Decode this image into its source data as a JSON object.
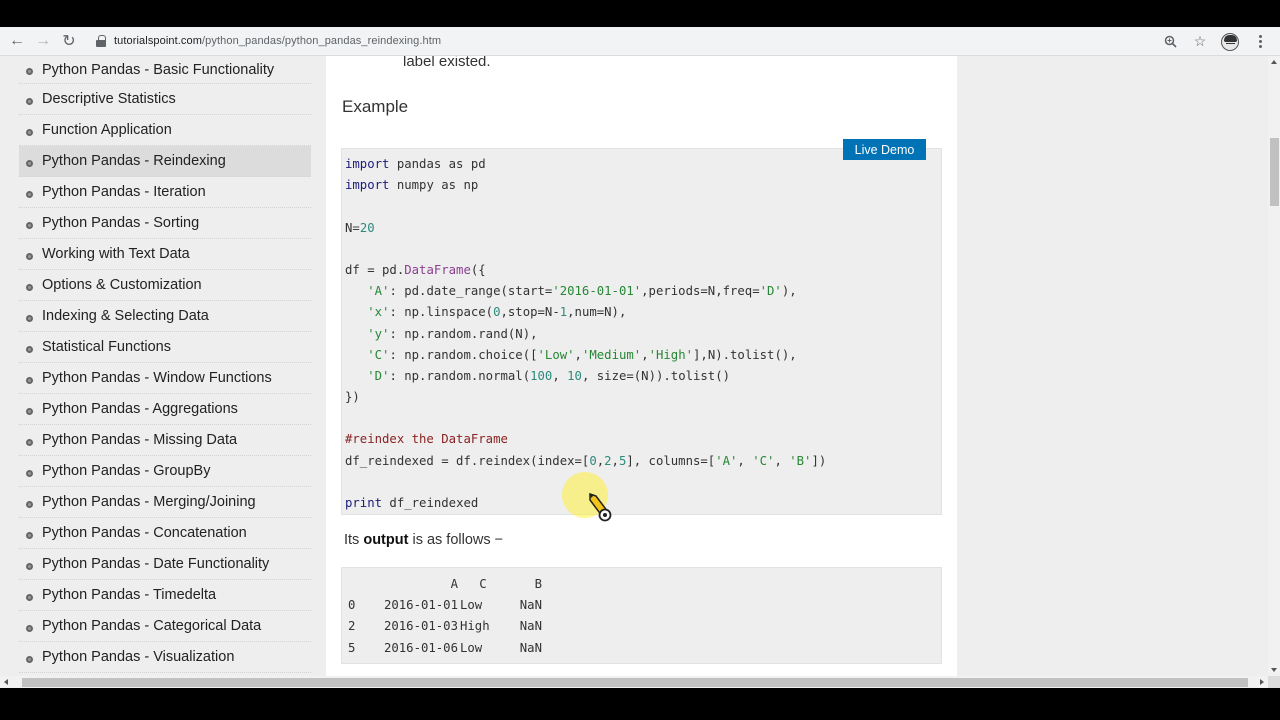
{
  "browser": {
    "url_host": "tutorialspoint.com",
    "url_path": "/python_pandas/python_pandas_reindexing.htm",
    "icons": [
      "back-arrow-icon",
      "forward-arrow-icon",
      "reload-icon",
      "lock-icon",
      "zoom-icon",
      "star-icon",
      "profile-avatar",
      "menu-kebab-icon"
    ]
  },
  "sidebar": {
    "active_index": 3,
    "items": [
      {
        "label": "Python Pandas - Basic Functionality"
      },
      {
        "label": "Descriptive Statistics"
      },
      {
        "label": "Function Application"
      },
      {
        "label": "Python Pandas - Reindexing"
      },
      {
        "label": "Python Pandas - Iteration"
      },
      {
        "label": "Python Pandas - Sorting"
      },
      {
        "label": "Working with Text Data"
      },
      {
        "label": "Options & Customization"
      },
      {
        "label": "Indexing & Selecting Data"
      },
      {
        "label": "Statistical Functions"
      },
      {
        "label": "Python Pandas - Window Functions"
      },
      {
        "label": "Python Pandas - Aggregations"
      },
      {
        "label": "Python Pandas - Missing Data"
      },
      {
        "label": "Python Pandas - GroupBy"
      },
      {
        "label": "Python Pandas - Merging/Joining"
      },
      {
        "label": "Python Pandas - Concatenation"
      },
      {
        "label": "Python Pandas - Date Functionality"
      },
      {
        "label": "Python Pandas - Timedelta"
      },
      {
        "label": "Python Pandas - Categorical Data"
      },
      {
        "label": "Python Pandas - Visualization"
      }
    ]
  },
  "content": {
    "partial_text": "label existed.",
    "example_heading": "Example",
    "live_demo_label": "Live Demo",
    "live_demo_color": "#0073b7",
    "code": {
      "l1": {
        "kw": "import",
        "rest": " pandas as pd"
      },
      "l2": {
        "kw": "import",
        "rest": " numpy as np"
      },
      "l4": {
        "a": "N",
        "b": "=",
        "c": "20"
      },
      "l6": {
        "a": "df = pd.",
        "b": "DataFrame",
        "c": "({"
      },
      "l7": {
        "a": "   ",
        "b": "'A'",
        "c": ": pd.date_range(start=",
        "d": "'2016-01-01'",
        "e": ",periods=N,freq=",
        "f": "'D'",
        "g": "),"
      },
      "l8": {
        "a": "   ",
        "b": "'x'",
        "c": ": np.linspace(",
        "d": "0",
        "e": ",stop=N-",
        "f": "1",
        "g": ",num=N),"
      },
      "l9": {
        "a": "   ",
        "b": "'y'",
        "c": ": np.random.rand(N),"
      },
      "l10": {
        "a": "   ",
        "b": "'C'",
        "c": ": np.random.choice([",
        "d": "'Low'",
        "e": ",",
        "f": "'Medium'",
        "g": ",",
        "h": "'High'",
        "i": "],N).tolist(),"
      },
      "l11": {
        "a": "   ",
        "b": "'D'",
        "c": ": np.random.normal(",
        "d": "100",
        "e": ", ",
        "f": "10",
        "g": ", size=(N)).tolist()"
      },
      "l12": {
        "a": "})"
      },
      "l14": {
        "a": "#reindex the DataFrame"
      },
      "l15": {
        "a": "df_reindexed = df.reindex(index=[",
        "b": "0",
        "c": ",",
        "d": "2",
        "e": ",",
        "f": "5",
        "g": "], columns=[",
        "h": "'A'",
        "i": ", ",
        "j": "'C'",
        "k": ", ",
        "l": "'B'",
        "m": "])"
      },
      "l17": {
        "kw": "print",
        "rest": " df_reindexed"
      }
    },
    "output_intro_pre": "Its ",
    "output_intro_bold": "output",
    "output_intro_post": " is as follows −",
    "output_table": {
      "headers": [
        "",
        "A",
        "C",
        "B"
      ],
      "rows": [
        [
          "0",
          "2016-01-01",
          "Low",
          "NaN"
        ],
        [
          "2",
          "2016-01-03",
          "High",
          "NaN"
        ],
        [
          "5",
          "2016-01-06",
          "Low",
          "NaN"
        ]
      ]
    }
  }
}
